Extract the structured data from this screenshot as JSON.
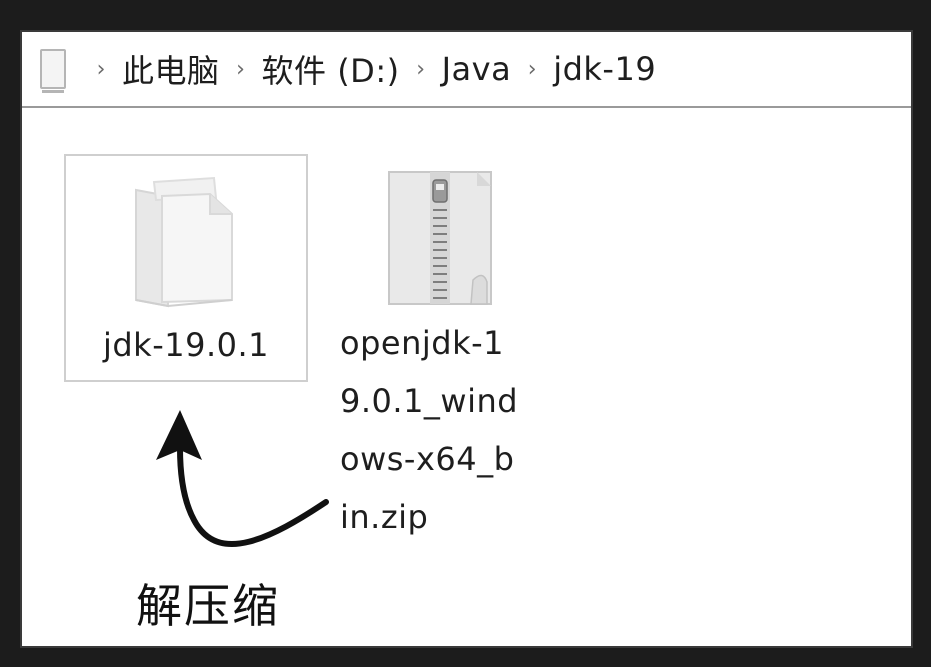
{
  "breadcrumb": {
    "items": [
      "此电脑",
      "软件 (D:)",
      "Java",
      "jdk-19"
    ],
    "separator": "›"
  },
  "files": [
    {
      "name": "jdk-19.0.1",
      "type": "folder",
      "selected": true,
      "icon": "folder-icon"
    },
    {
      "name": "openjdk-1\n9.0.1_wind\nows-x64_b\nin.zip",
      "type": "zip",
      "selected": false,
      "icon": "zip-archive-icon"
    }
  ],
  "annotation": {
    "text": "解压缩"
  },
  "colors": {
    "window_bg": "#ffffff",
    "frame": "#3a3a3a",
    "selection_border": "#cfcfcf",
    "text": "#1e1e1e"
  }
}
